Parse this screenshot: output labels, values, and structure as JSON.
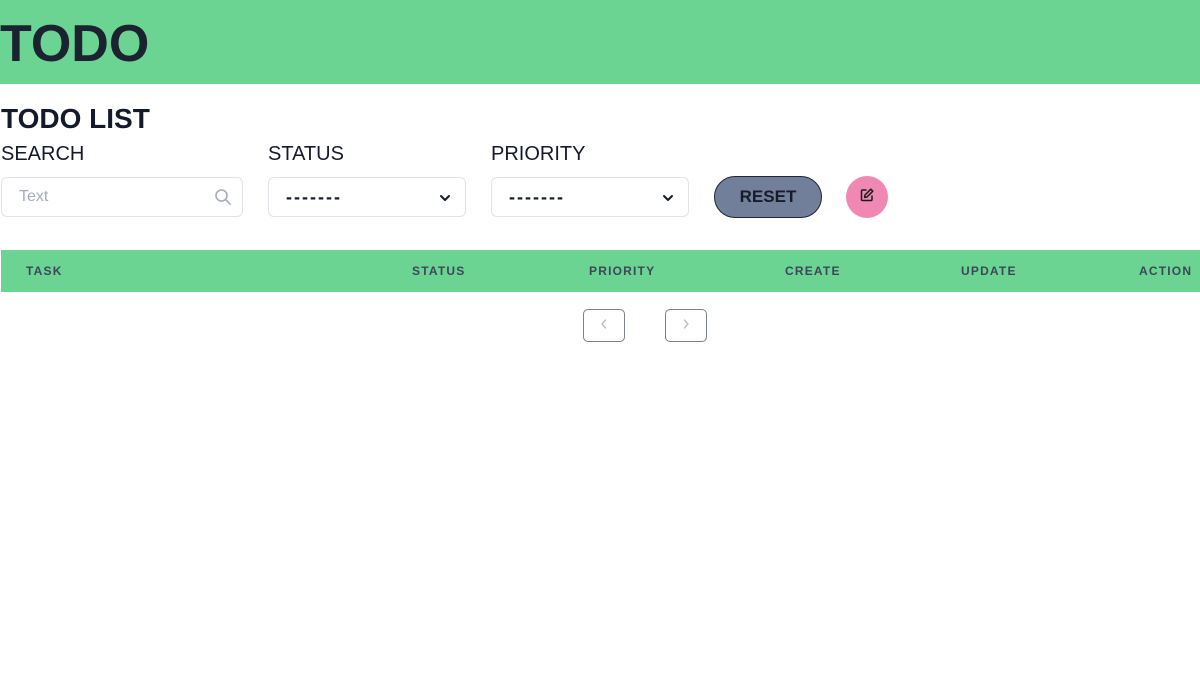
{
  "header": {
    "title": "TODO"
  },
  "page": {
    "title": "TODO LIST"
  },
  "filters": {
    "search": {
      "label": "SEARCH",
      "placeholder": "Text",
      "value": ""
    },
    "status": {
      "label": "STATUS",
      "selected": "-------"
    },
    "priority": {
      "label": "PRIORITY",
      "selected": "-------"
    }
  },
  "actions": {
    "reset_label": "RESET",
    "edit_icon": "edit-icon"
  },
  "table": {
    "columns": [
      "TASK",
      "STATUS",
      "PRIORITY",
      "CREATE",
      "UPDATE",
      "ACTION"
    ],
    "rows": []
  },
  "pagination": {
    "prev_icon": "chevron-left-icon",
    "next_icon": "chevron-right-icon"
  },
  "colors": {
    "header_bg": "#6bd492",
    "reset_button_bg": "#717f9b",
    "edit_button_bg": "#f088b4"
  }
}
